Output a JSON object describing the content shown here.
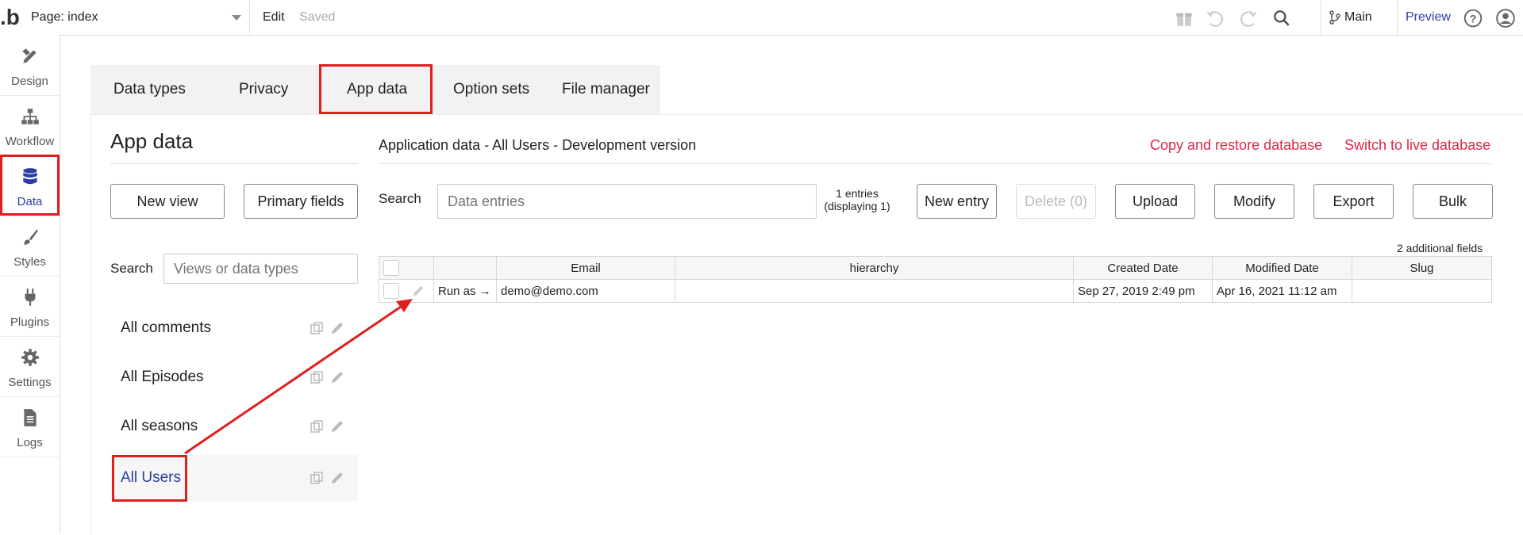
{
  "topbar": {
    "logo": ".b",
    "page_label": "Page: index",
    "edit_label": "Edit",
    "saved_label": "Saved",
    "branch_label": "Main",
    "preview_label": "Preview"
  },
  "sidebar": {
    "items": [
      {
        "label": "Design",
        "icon": "design-icon"
      },
      {
        "label": "Workflow",
        "icon": "workflow-icon"
      },
      {
        "label": "Data",
        "icon": "database-icon"
      },
      {
        "label": "Styles",
        "icon": "brush-icon"
      },
      {
        "label": "Plugins",
        "icon": "plug-icon"
      },
      {
        "label": "Settings",
        "icon": "gear-icon"
      },
      {
        "label": "Logs",
        "icon": "document-icon"
      }
    ],
    "active": "Data"
  },
  "tabs": [
    "Data types",
    "Privacy",
    "App data",
    "Option sets",
    "File manager"
  ],
  "active_tab": "App data",
  "left_panel": {
    "title": "App data",
    "new_view_label": "New view",
    "primary_fields_label": "Primary fields",
    "search_label": "Search",
    "search_placeholder": "Views or data types",
    "views": [
      "All comments",
      "All Episodes",
      "All seasons",
      "All Users"
    ],
    "active_view": "All Users"
  },
  "main": {
    "heading": "Application data - All Users - Development version",
    "copy_restore_label": "Copy and restore database",
    "switch_live_label": "Switch to live database",
    "search_label": "Search",
    "search_placeholder": "Data entries",
    "entries_count": "1 entries",
    "entries_display": "(displaying 1)",
    "buttons": {
      "new_entry": "New entry",
      "delete": "Delete (0)",
      "upload": "Upload",
      "modify": "Modify",
      "export": "Export",
      "bulk": "Bulk"
    },
    "additional_fields": "2 additional fields",
    "table": {
      "columns": [
        "Email",
        "hierarchy",
        "Created Date",
        "Modified Date",
        "Slug"
      ],
      "rows": [
        {
          "run_as": "Run as →",
          "email": "demo@demo.com",
          "hierarchy": "",
          "created": "Sep 27, 2019 2:49 pm",
          "modified": "Apr 16, 2021 11:12 am",
          "slug": ""
        }
      ]
    }
  },
  "colors": {
    "accent": "#2c3da6",
    "highlight": "#e01e1e",
    "danger_link": "#e0264a"
  }
}
